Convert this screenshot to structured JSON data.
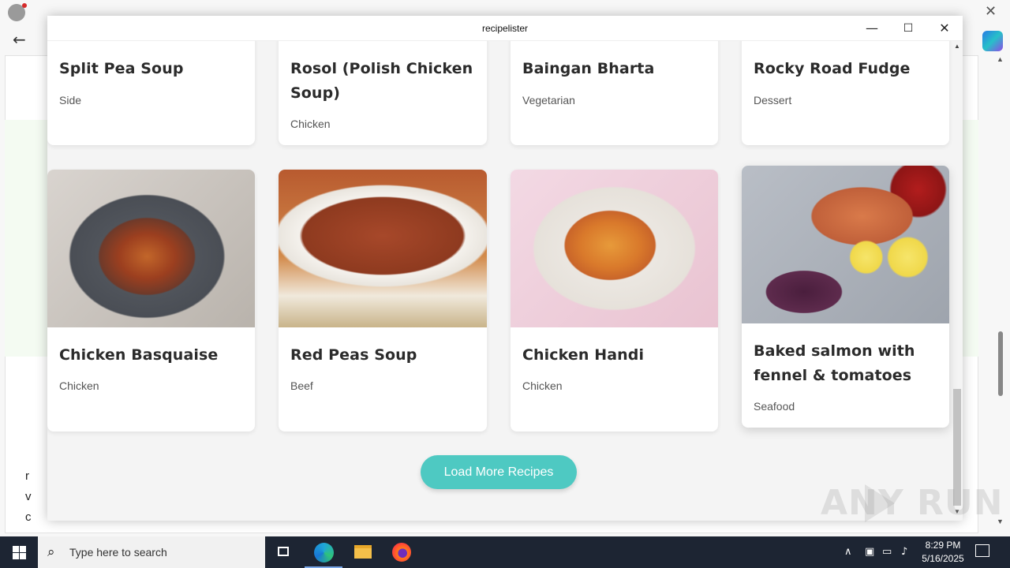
{
  "window": {
    "title": "recipelister",
    "minimize_glyph": "—",
    "maximize_glyph": "☐",
    "close_glyph": "✕"
  },
  "cards_top": [
    {
      "name": "Split Pea Soup",
      "category": "Side"
    },
    {
      "name": "Rosol (Polish Chicken Soup)",
      "category": "Chicken"
    },
    {
      "name": "Baingan Bharta",
      "category": "Vegetarian"
    },
    {
      "name": "Rocky Road Fudge",
      "category": "Dessert"
    }
  ],
  "cards_bottom": [
    {
      "name": "Chicken Basquaise",
      "category": "Chicken",
      "image": "chicken-basquaise-photo"
    },
    {
      "name": "Red Peas Soup",
      "category": "Beef",
      "image": "red-peas-soup-photo"
    },
    {
      "name": "Chicken Handi",
      "category": "Chicken",
      "image": "chicken-handi-photo"
    },
    {
      "name": "Baked salmon with fennel & tomatoes",
      "category": "Seafood",
      "image": "baked-salmon-photo"
    }
  ],
  "load_more_label": "Load More Recipes",
  "colors": {
    "accent": "#4ec9c2",
    "taskbar": "#1d2533"
  },
  "background_text": [
    "r",
    "v",
    "c"
  ],
  "watermark": {
    "text": "ANY RUN"
  },
  "taskbar": {
    "search_placeholder": "Type here to search",
    "time": "8:29 PM",
    "date": "5/16/2025",
    "icons": [
      "windows-start-icon",
      "task-view-icon",
      "edge-icon",
      "file-explorer-icon",
      "firefox-icon"
    ],
    "tray_icons": [
      "chevron-up-icon",
      "network-icon",
      "speaker-icon",
      "notifications-icon"
    ]
  }
}
